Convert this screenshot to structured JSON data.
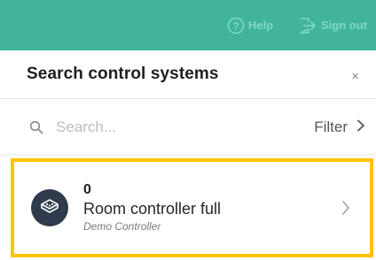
{
  "topbar": {
    "help_label": "Help",
    "signout_label": "Sign out",
    "color": "#41b49a"
  },
  "panel": {
    "title": "Search control systems",
    "close_glyph": "×"
  },
  "search": {
    "placeholder": "Search...",
    "value": "",
    "filter_label": "Filter"
  },
  "results": [
    {
      "number": "0",
      "name": "Room controller full",
      "type": "Demo Controller",
      "icon": "controller-icon"
    }
  ],
  "highlight_color": "#ffc200"
}
